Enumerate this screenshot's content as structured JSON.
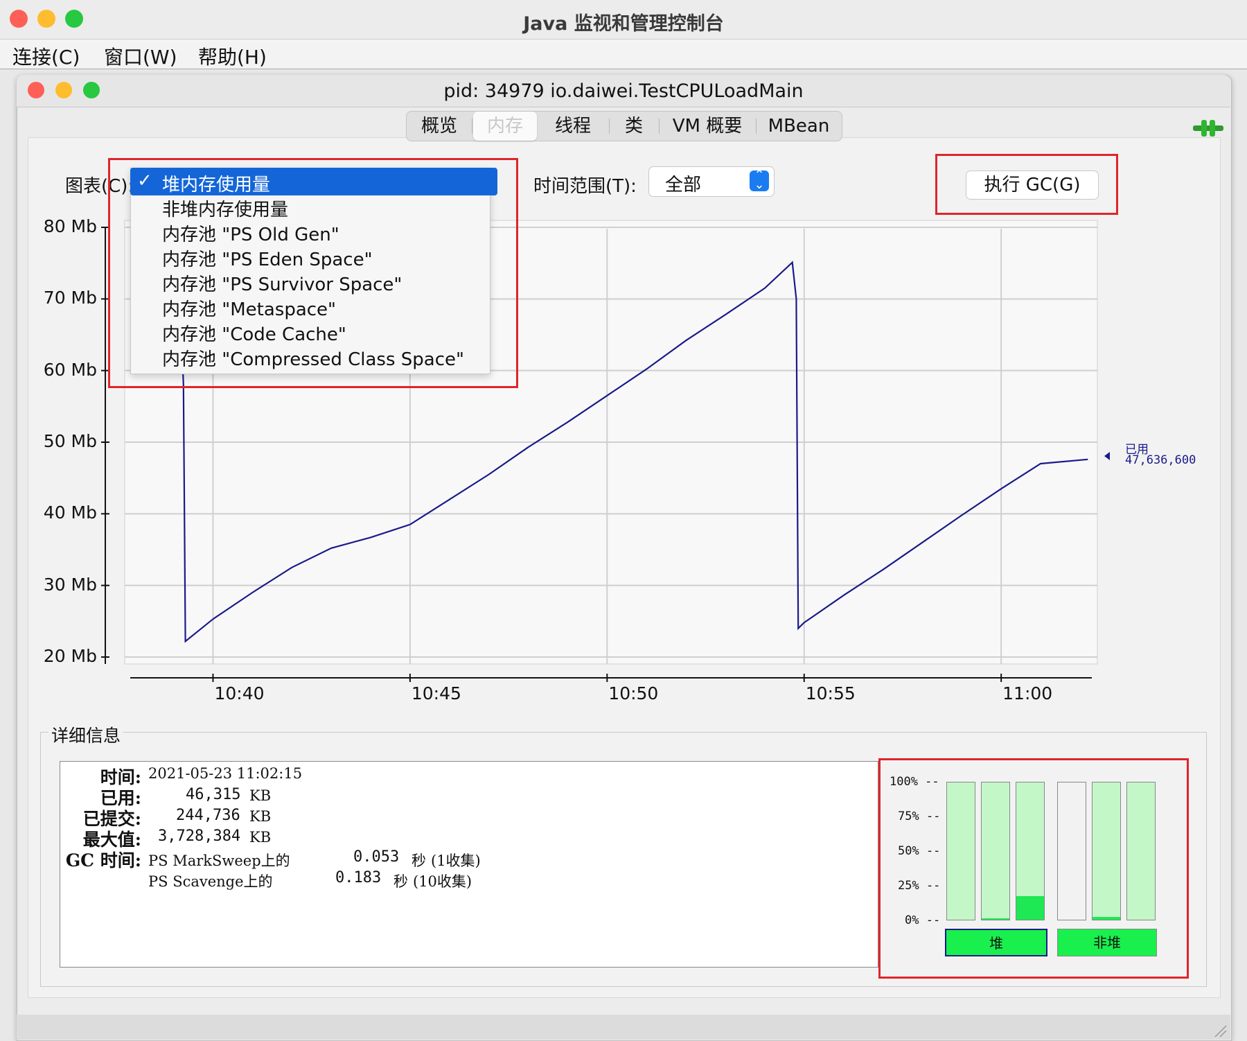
{
  "app": {
    "title": "Java 监视和管理控制台"
  },
  "menu": [
    "连接(C)",
    "窗口(W)",
    "帮助(H)"
  ],
  "window": {
    "title": "pid: 34979 io.daiwei.TestCPULoadMain"
  },
  "tabs": [
    "概览",
    "内存",
    "线程",
    "类",
    "VM 概要",
    "MBean"
  ],
  "selected_tab": "内存",
  "controls": {
    "chart_label": "图表(C):",
    "range_label": "时间范围(T):",
    "range_value": "全部",
    "gc_button": "执行 GC(G)"
  },
  "dropdown": {
    "check": "✓",
    "items": [
      "堆内存使用量",
      "非堆内存使用量",
      "内存池 \"PS Old Gen\"",
      "内存池 \"PS Eden Space\"",
      "内存池 \"PS Survivor Space\"",
      "内存池 \"Metaspace\"",
      "内存池 \"Code Cache\"",
      "内存池 \"Compressed Class Space\""
    ],
    "selected_index": 0
  },
  "chart_data": {
    "type": "line",
    "ylabel_ticks": [
      "20 Mb",
      "30 Mb",
      "40 Mb",
      "50 Mb",
      "60 Mb",
      "70 Mb",
      "80 Mb"
    ],
    "y_ticks": [
      20,
      30,
      40,
      50,
      60,
      70,
      80
    ],
    "ylim": [
      20,
      80
    ],
    "x_ticks": [
      "10:40",
      "10:45",
      "10:50",
      "10:55",
      "11:00"
    ],
    "x_tick_minutes": [
      40,
      45,
      50,
      55,
      60
    ],
    "xlim_minutes": [
      37.9,
      62.3
    ],
    "grid": true,
    "series": [
      {
        "name": "已用",
        "color": "#1a1a8a",
        "x_minutes": [
          39.2,
          39.25,
          39.3,
          40,
          41,
          42,
          43,
          44,
          45,
          46,
          47,
          48,
          49,
          50,
          51,
          52,
          53,
          54,
          54.7,
          54.8,
          54.85,
          55.0,
          56,
          57,
          58,
          59,
          60,
          61,
          62.2
        ],
        "values": [
          65,
          58,
          22.2,
          25.3,
          29,
          32.5,
          35.2,
          36.7,
          38.5,
          42,
          45.5,
          49.3,
          52.8,
          56.5,
          60.2,
          64.2,
          67.8,
          71.5,
          75.1,
          70,
          24,
          24.8,
          28.6,
          32.2,
          36,
          39.8,
          43.5,
          47.0,
          47.6
        ]
      }
    ],
    "current_label": "已用",
    "current_value": "47,636,600"
  },
  "details": {
    "legend": "详细信息",
    "rows": [
      {
        "key": "时间:",
        "value": "2021-05-23 11:02:15"
      },
      {
        "key": "已用:",
        "num": "46,315",
        "unit": "KB"
      },
      {
        "key": "已提交:",
        "num": "244,736",
        "unit": "KB"
      },
      {
        "key": "最大值:",
        "num": "3,728,384",
        "unit": "KB"
      }
    ],
    "gc_key": "GC 时间:",
    "gc_rows": [
      {
        "collector": "PS MarkSweep上的",
        "time": "0.053",
        "unit": "秒",
        "count": "(1收集)"
      },
      {
        "collector": "PS Scavenge上的",
        "time": "0.183",
        "unit": "秒",
        "count": "(10收集)"
      }
    ]
  },
  "bars": {
    "pct_labels": [
      "100% --",
      "75% --",
      "50% --",
      "25% --",
      "0% --"
    ],
    "heap_label": "堆",
    "nonheap_label": "非堆",
    "heap_fill_pct": [
      0,
      1,
      17
    ],
    "nonheap_fill_pct": [
      0,
      2,
      0
    ],
    "nonheap_empty_first": true
  }
}
